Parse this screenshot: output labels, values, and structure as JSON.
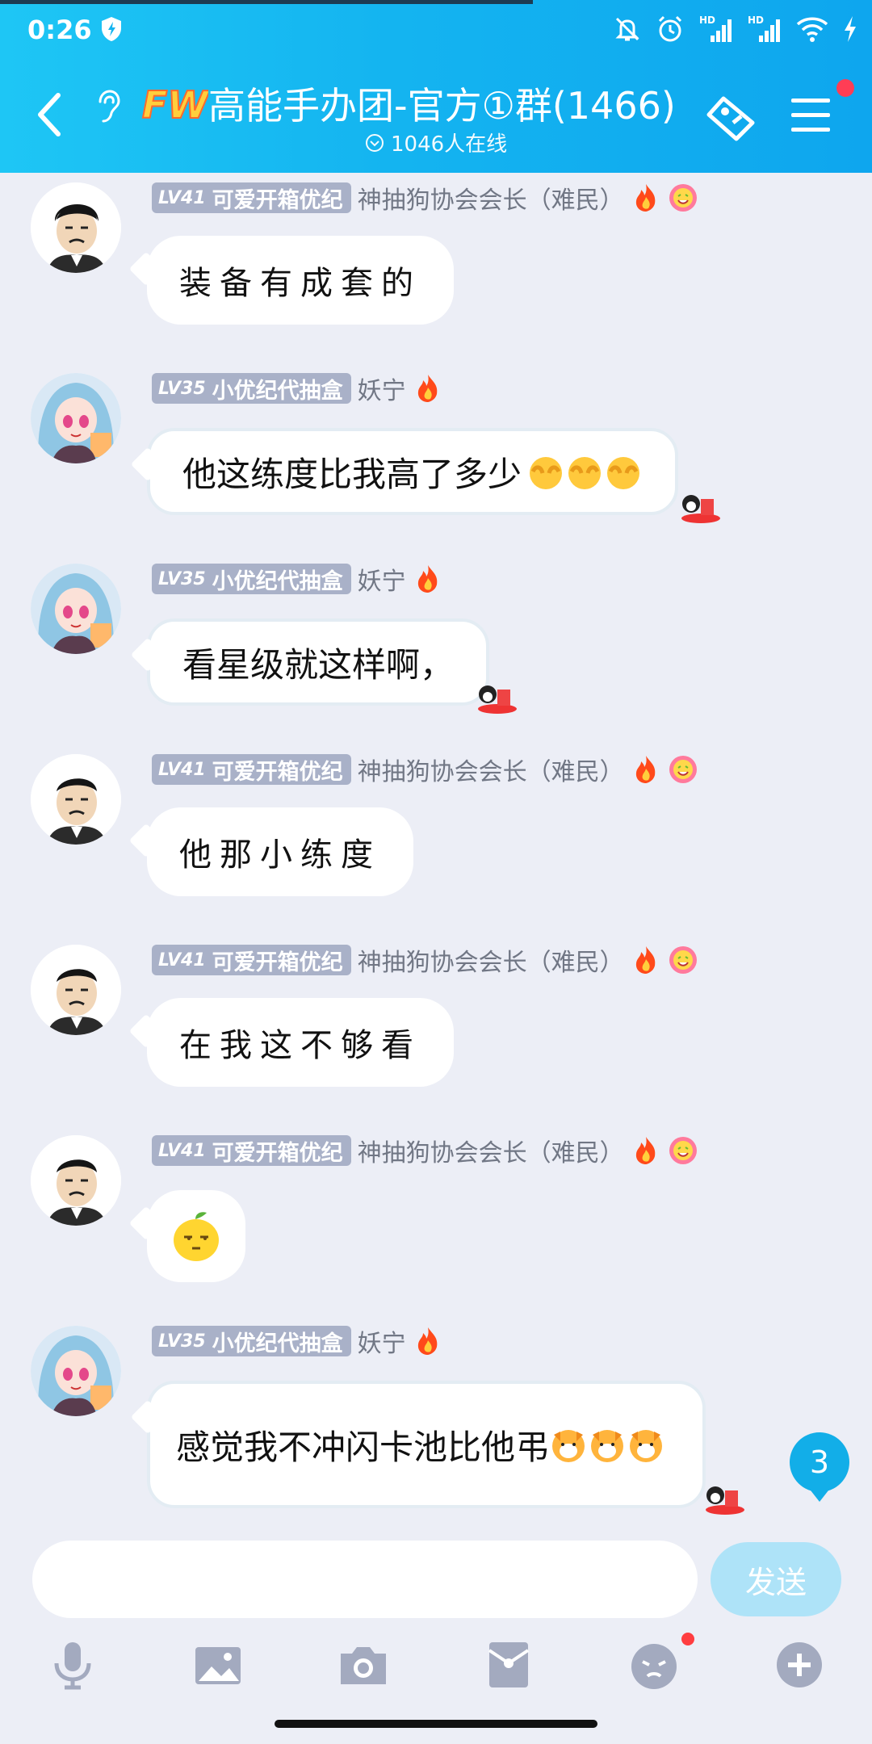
{
  "status_bar": {
    "time": "0:26",
    "icons": [
      "shield-icon",
      "bell-off-icon",
      "alarm-icon",
      "signal-hd-icon",
      "signal-hd-icon",
      "wifi-icon",
      "charging-icon"
    ],
    "hd_label": "HD"
  },
  "header": {
    "logo_text": "FW",
    "title": "高能手办团-官方①群(1466)",
    "online": "1046人在线",
    "colors": {
      "gradient_start": "#1ec6f5",
      "gradient_end": "#0ea6ee"
    }
  },
  "messages": [
    {
      "lv": "LV41",
      "title": "可爱开箱优纪",
      "nick": "神抽狗协会会长（难民）",
      "text": "装备有成套的",
      "avatar": "man-avatar"
    },
    {
      "lv": "LV35",
      "title": "小优纪代抽盒",
      "nick": "妖宁",
      "text": "他这练度比我高了多少",
      "avatar": "girl-avatar"
    },
    {
      "lv": "LV35",
      "title": "小优纪代抽盒",
      "nick": "妖宁",
      "text": "看星级就这样啊，",
      "avatar": "girl-avatar"
    },
    {
      "lv": "LV41",
      "title": "可爱开箱优纪",
      "nick": "神抽狗协会会长（难民）",
      "text": "他那小练度",
      "avatar": "man-avatar"
    },
    {
      "lv": "LV41",
      "title": "可爱开箱优纪",
      "nick": "神抽狗协会会长（难民）",
      "text": "在我这不够看",
      "avatar": "man-avatar"
    },
    {
      "lv": "LV41",
      "title": "可爱开箱优纪",
      "nick": "神抽狗协会会长（难民）",
      "text": "",
      "avatar": "man-avatar"
    },
    {
      "lv": "LV35",
      "title": "小优纪代抽盒",
      "nick": "妖宁",
      "text": "感觉我不冲闪卡池比他弔",
      "avatar": "girl-avatar"
    }
  ],
  "unread_count": "3",
  "input": {
    "placeholder": "",
    "send_label": "发送",
    "send_color": "#aee3f8"
  },
  "toolbar": [
    "mic-icon",
    "image-icon",
    "camera-icon",
    "red-packet-icon",
    "emoji-icon",
    "plus-icon"
  ]
}
